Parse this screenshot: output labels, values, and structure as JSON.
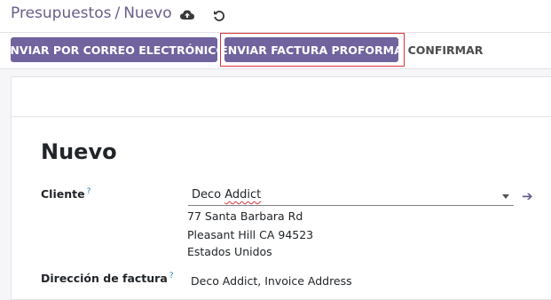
{
  "breadcrumb": {
    "parent": "Presupuestos",
    "separator": "/",
    "current": "Nuevo"
  },
  "toolbar": {
    "save_icon": "cloud-upload-icon",
    "discard_icon": "undo-icon"
  },
  "actions": {
    "email_label": "ENVIAR POR CORREO ELECTRÓNICO",
    "proforma_label": "ENVIAR FACTURA PROFORMA",
    "confirm_label": "CONFIRMAR"
  },
  "form": {
    "title": "Nuevo",
    "client": {
      "label": "Cliente",
      "help": "?",
      "value_prefix": "Deco ",
      "value_misspelled": "Addict",
      "address_line1": "77 Santa Barbara Rd",
      "address_line2": "Pleasant Hill CA 94523",
      "address_line3": "Estados Unidos"
    },
    "invoice_address": {
      "label": "Dirección de factura",
      "help": "?",
      "value": "Deco Addict, Invoice Address"
    }
  },
  "colors": {
    "primary": "#71639e",
    "highlight": "#d9363e",
    "link": "#6a5d88"
  }
}
